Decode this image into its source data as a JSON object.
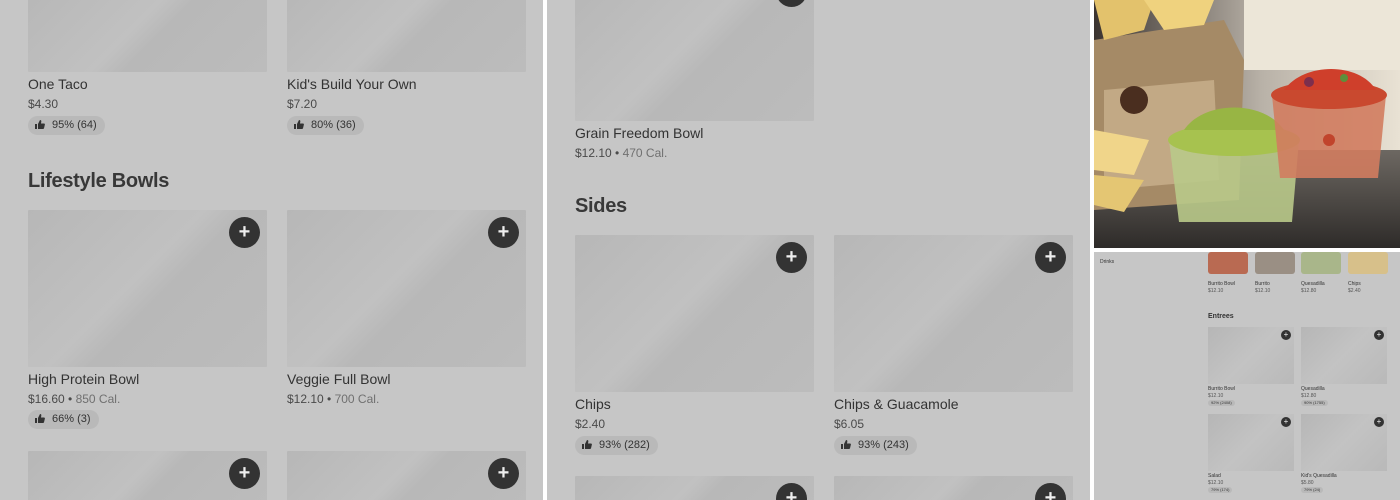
{
  "left_panel": {
    "top_items": [
      {
        "name": "One Taco",
        "price": "$4.30",
        "rating": "95% (64)"
      },
      {
        "name": "Kid's Build Your Own",
        "price": "$7.20",
        "rating": "80% (36)"
      }
    ],
    "section_title": "Lifestyle Bowls",
    "items": [
      {
        "name": "High Protein Bowl",
        "price": "$16.60",
        "cal": "850 Cal.",
        "rating": "66% (3)"
      },
      {
        "name": "Veggie Full Bowl",
        "price": "$12.10",
        "cal": "700 Cal."
      }
    ]
  },
  "middle_panel": {
    "top_item": {
      "name": "Grain Freedom Bowl",
      "price": "$12.10",
      "cal": "470 Cal."
    },
    "section_title": "Sides",
    "items": [
      {
        "name": "Chips",
        "price": "$2.40",
        "rating": "93% (282)"
      },
      {
        "name": "Chips & Guacamole",
        "price": "$6.05",
        "rating": "93% (243)"
      }
    ]
  },
  "mini_panel": {
    "sidebar_label": "Drinks",
    "featured": [
      {
        "name": "Burrito Bowl",
        "price": "$12.10"
      },
      {
        "name": "Burrito",
        "price": "$12.10"
      },
      {
        "name": "Quesadilla",
        "price": "$12.80"
      },
      {
        "name": "Chips",
        "price": "$2.40"
      }
    ],
    "section_title": "Entrees",
    "items": [
      {
        "name": "Burrito Bowl",
        "price": "$12.10",
        "rating": "92% (2408)"
      },
      {
        "name": "Quesadilla",
        "price": "$12.80",
        "rating": "90% (1755)"
      },
      {
        "name": "Salad",
        "price": "$12.10",
        "rating": "79% (174)"
      },
      {
        "name": "Kid's Quesadilla",
        "price": "$5.80",
        "rating": "79% (24)"
      }
    ]
  },
  "icons": {
    "add": "+",
    "thumb": "thumbs-up-icon"
  }
}
